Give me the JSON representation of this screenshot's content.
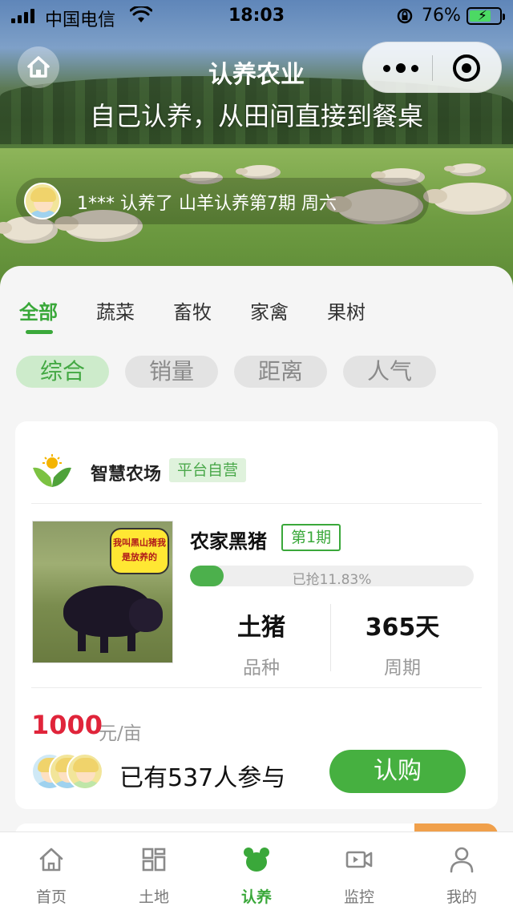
{
  "status_bar": {
    "carrier": "中国电信",
    "time": "18:03",
    "battery_percent": "76%",
    "battery_level": 0.76,
    "signal_bars": 4
  },
  "nav": {
    "title": "认养农业",
    "home_icon": "home-icon",
    "more_icon": "more-dots-icon",
    "close_icon": "close-target-icon"
  },
  "hero": {
    "slogan": "自己认养，从田间直接到餐桌",
    "ticker_text": "1*** 认养了 山羊认养第7期 周六"
  },
  "category_tabs": [
    {
      "label": "全部",
      "active": true
    },
    {
      "label": "蔬菜",
      "active": false
    },
    {
      "label": "畜牧",
      "active": false
    },
    {
      "label": "家禽",
      "active": false
    },
    {
      "label": "果树",
      "active": false
    }
  ],
  "sort_chips": [
    {
      "label": "综合",
      "active": true
    },
    {
      "label": "销量",
      "active": false
    },
    {
      "label": "距离",
      "active": false
    },
    {
      "label": "人气",
      "active": false
    }
  ],
  "product_card": {
    "farm_name": "智慧农场",
    "farm_badge": "平台自营",
    "image_caption": "我叫黑山猪我是放养的",
    "title": "农家黑猪",
    "period": "第1期",
    "progress_text": "已抢11.83%",
    "progress_value": 0.1183,
    "breed_value": "土猪",
    "breed_label": "品种",
    "cycle_value": "365天",
    "cycle_label": "周期",
    "price": "1000",
    "unit": "元/亩",
    "participants": "已有537人参与",
    "buy_label": "认购"
  },
  "bottom_tabs": [
    {
      "label": "首页",
      "icon": "home-icon",
      "active": false
    },
    {
      "label": "土地",
      "icon": "grid-icon",
      "active": false
    },
    {
      "label": "认养",
      "icon": "adopt-icon",
      "active": true
    },
    {
      "label": "监控",
      "icon": "video-icon",
      "active": false
    },
    {
      "label": "我的",
      "icon": "user-icon",
      "active": false
    }
  ],
  "colors": {
    "accent": "#3aa83a",
    "price": "#e0243a",
    "button": "#46b040"
  }
}
